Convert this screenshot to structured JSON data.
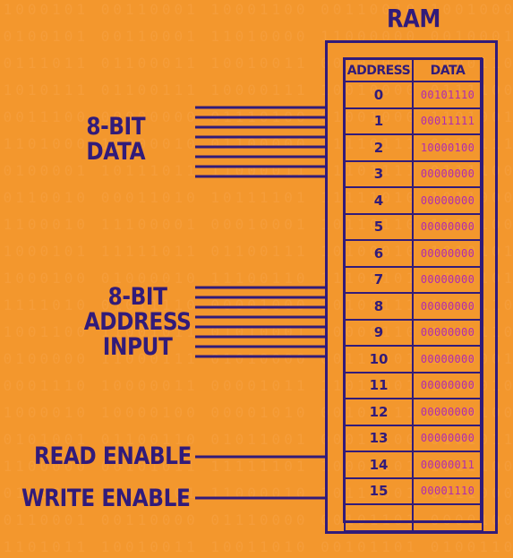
{
  "ram_title": "RAM",
  "labels": {
    "data_line1": "8-BIT",
    "data_line2": "DATA",
    "address_line1": "8-BIT",
    "address_line2": "ADDRESS",
    "address_line3": "INPUT",
    "read_enable": "READ ENABLE",
    "write_enable": "WRITE ENABLE"
  },
  "table": {
    "header_address": "ADDRESS",
    "header_data": "DATA",
    "rows": [
      {
        "address": "0",
        "data": "00101110"
      },
      {
        "address": "1",
        "data": "00011111"
      },
      {
        "address": "2",
        "data": "10000100"
      },
      {
        "address": "3",
        "data": "00000000"
      },
      {
        "address": "4",
        "data": "00000000"
      },
      {
        "address": "5",
        "data": "00000000"
      },
      {
        "address": "6",
        "data": "00000000"
      },
      {
        "address": "7",
        "data": "00000000"
      },
      {
        "address": "8",
        "data": "00000000"
      },
      {
        "address": "9",
        "data": "00000000"
      },
      {
        "address": "10",
        "data": "00000000"
      },
      {
        "address": "11",
        "data": "00000000"
      },
      {
        "address": "12",
        "data": "00000000"
      },
      {
        "address": "13",
        "data": "00000000"
      },
      {
        "address": "14",
        "data": "00000011"
      },
      {
        "address": "15",
        "data": "00001110"
      },
      {
        "address": "",
        "data": ""
      }
    ]
  },
  "colors": {
    "background": "#f3972d",
    "ink": "#311b7a",
    "data_value": "#b02bb0"
  }
}
